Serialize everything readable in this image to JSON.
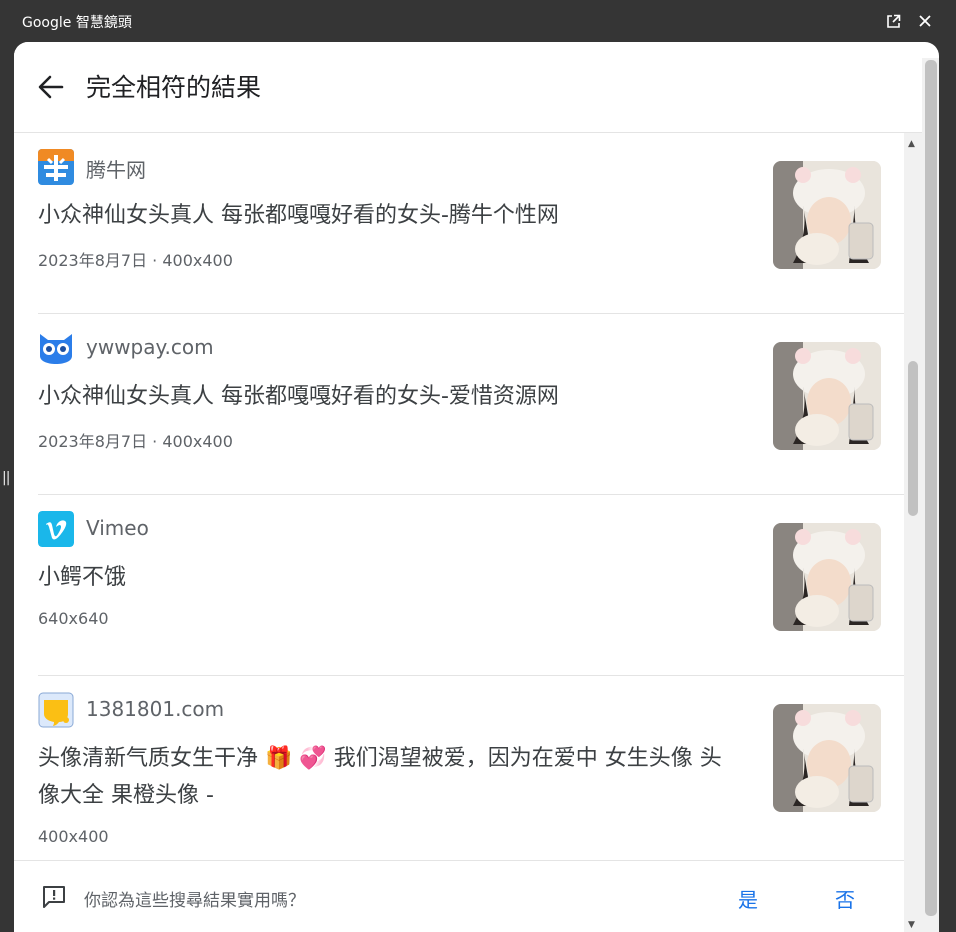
{
  "window": {
    "title": "Google 智慧鏡頭"
  },
  "header": {
    "title": "完全相符的結果"
  },
  "results": [
    {
      "site": "腾牛网",
      "title": "小众神仙女头真人 每张都嘎嘎好看的女头-腾牛个性网",
      "meta": "2023年8月7日 · 400x400",
      "favicon": "tengniu-logo"
    },
    {
      "site": "ywwpay.com",
      "title": "小众神仙女头真人 每张都嘎嘎好看的女头-爱惜资源网",
      "meta": "2023年8月7日 · 400x400",
      "favicon": "owl-logo"
    },
    {
      "site": "Vimeo",
      "title": "小鳄不饿",
      "meta": "640x640",
      "favicon": "vimeo-logo"
    },
    {
      "site": "1381801.com",
      "title": "头像清新气质女生干净 🎁 💞 我们渴望被爱，因为在爱中 女生头像 头像大全 果橙头像 -",
      "meta": "400x400",
      "favicon": "yellow-bubble-logo"
    }
  ],
  "footer": {
    "question": "你認為這些搜尋結果實用嗎？",
    "yes": "是",
    "no": "否"
  },
  "colors": {
    "accent": "#1a73e8",
    "titlebar": "#353535"
  }
}
